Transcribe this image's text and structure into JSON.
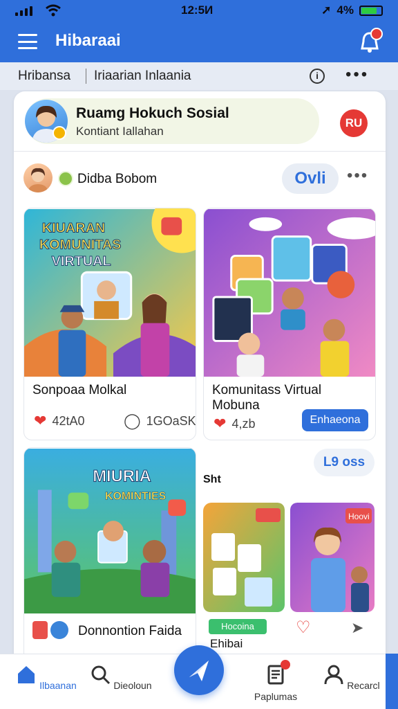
{
  "status_bar": {
    "time": "12:5И",
    "battery": "4%"
  },
  "app_bar": {
    "title": "Hibaraai"
  },
  "sub_bar": {
    "left": "Hribansa",
    "right": "Iriaarian Inlaania"
  },
  "profile": {
    "name": "Ruamg Hokuch Sosial",
    "subtitle": "Kontiant Iallahan",
    "button": "RU"
  },
  "post": {
    "author": "Didba Bobom",
    "pill": "Ovli"
  },
  "tiles": [
    {
      "image_text": [
        "KIUARAN",
        "KOMUNITAS",
        "VIRTUAL"
      ],
      "title": "Sonpoaa Molkal",
      "likes": "42tА0",
      "comments": "1GOaSK"
    },
    {
      "title_line1": "Komunitass Virtual",
      "title_line2": "Mobuna",
      "likes": "4,zb",
      "button": "Enhaeona"
    },
    {
      "image_text": [
        "MIURIA",
        "KOMINTIES"
      ],
      "title": "Donnontion Faida"
    },
    {
      "image_tag": "Hoovi",
      "badge": "Hocoina",
      "title": "Ehibai"
    }
  ],
  "extra": {
    "pill": "L9 oss",
    "label": "Sht"
  },
  "bottom_nav": [
    {
      "label": "Ilbaanan",
      "icon": "home-icon"
    },
    {
      "label": "Dieoloun",
      "icon": "search-icon"
    },
    {
      "label": "Paplumas",
      "icon": "document-icon"
    },
    {
      "label": "Recarcl",
      "icon": "user-icon"
    }
  ],
  "colors": {
    "primary": "#2f6fdb",
    "accent_red": "#e53935"
  }
}
